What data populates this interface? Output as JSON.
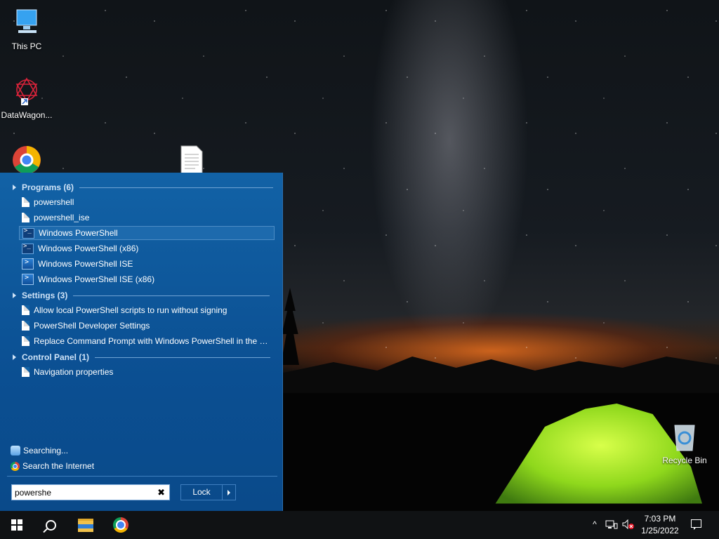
{
  "desktop": {
    "icons": [
      {
        "label": "This PC"
      },
      {
        "label": "DataWagon..."
      },
      {
        "label": "Recycle Bin"
      }
    ]
  },
  "start_menu": {
    "groups": [
      {
        "title": "Programs (6)",
        "items": [
          {
            "label": "powershell",
            "icon": "document-icon"
          },
          {
            "label": "powershell_ise",
            "icon": "document-icon"
          },
          {
            "label": "Windows PowerShell",
            "icon": "powershell-icon",
            "selected": true
          },
          {
            "label": "Windows PowerShell (x86)",
            "icon": "powershell-icon"
          },
          {
            "label": "Windows PowerShell ISE",
            "icon": "powershell-ise-icon"
          },
          {
            "label": "Windows PowerShell ISE (x86)",
            "icon": "powershell-ise-icon"
          }
        ]
      },
      {
        "title": "Settings (3)",
        "items": [
          {
            "label": "Allow local PowerShell scripts to run without signing",
            "icon": "document-icon"
          },
          {
            "label": "PowerShell Developer Settings",
            "icon": "document-icon"
          },
          {
            "label": "Replace Command Prompt with Windows PowerShell in the W...",
            "icon": "document-icon"
          }
        ]
      },
      {
        "title": "Control Panel (1)",
        "items": [
          {
            "label": "Navigation properties",
            "icon": "document-icon"
          }
        ]
      }
    ],
    "searching_label": "Searching...",
    "search_internet_label": "Search the Internet",
    "search_value": "powershe",
    "lock_label": "Lock"
  },
  "taskbar": {
    "time": "7:03 PM",
    "date": "1/25/2022"
  },
  "colors": {
    "menu_bg": "#1262a6",
    "selected_item": "#1d6aad",
    "taskbar": "#101214"
  }
}
